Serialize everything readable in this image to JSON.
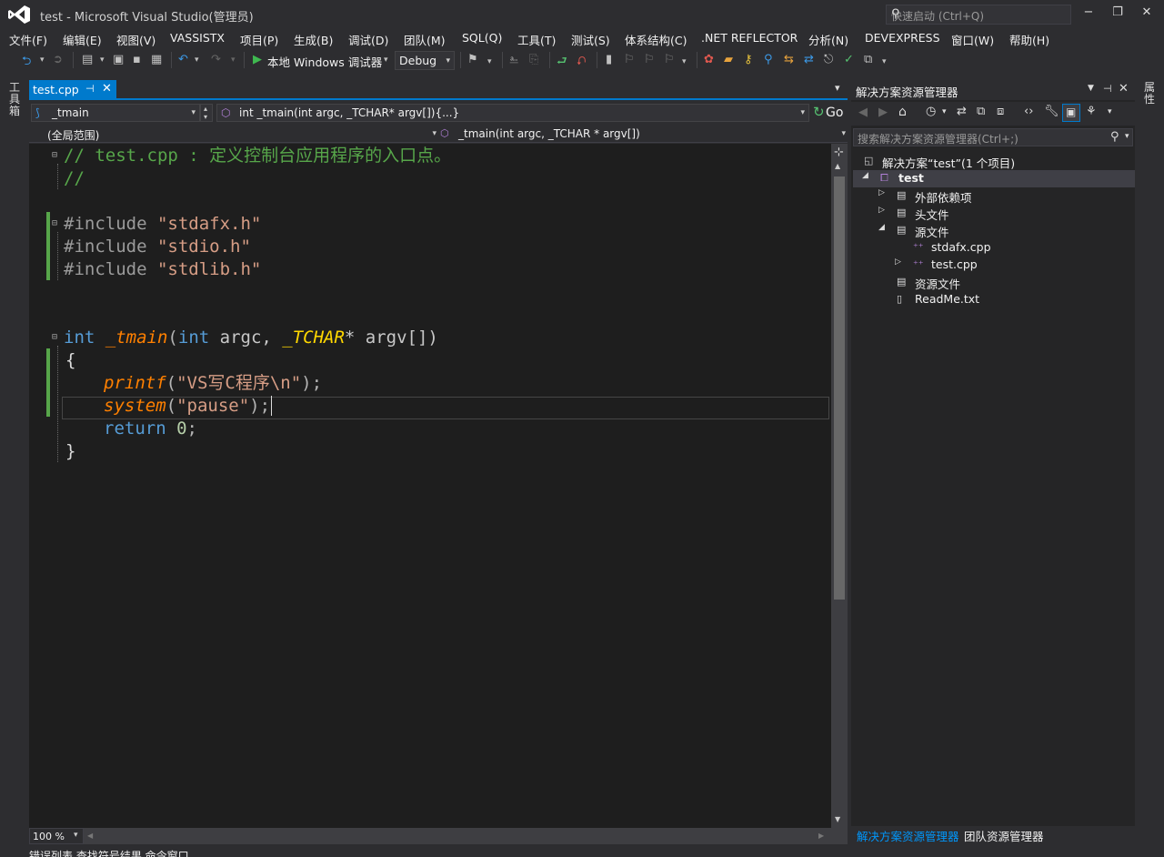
{
  "window": {
    "title": "test - Microsoft Visual Studio(管理员)",
    "quick_launch_placeholder": "快速启动 (Ctrl+Q)",
    "minimize": "−",
    "restore": "❐",
    "close": "✕"
  },
  "menu": [
    "文件(F)",
    "编辑(E)",
    "视图(V)",
    "VASSISTX",
    "项目(P)",
    "生成(B)",
    "调试(D)",
    "团队(M)",
    "SQL(Q)",
    "工具(T)",
    "测试(S)",
    "体系结构(C)",
    ".NET REFLECTOR",
    "分析(N)",
    "DEVEXPRESS",
    "窗口(W)",
    "帮助(H)"
  ],
  "toolbar": {
    "run_label": "本地 Windows 调试器",
    "config": "Debug"
  },
  "left_rail_label": "工具箱",
  "right_rail_label": "属性",
  "editor": {
    "tab_name": "test.cpp",
    "tab_pin": "⊣",
    "tab_close": "✕",
    "scope_combo": "_tmain",
    "function_combo": "int _tmain(int argc, _TCHAR* argv[]){...}",
    "go_label": "Go",
    "global_scope": "(全局范围)",
    "member_combo": "_tmain(int argc, _TCHAR * argv[])",
    "zoom": "100 %",
    "lines": {
      "l1": "// test.cpp : 定义控制台应用程序的入口点。",
      "l2": "//",
      "inc_kw": "#include",
      "inc1": "\"stdafx.h\"",
      "inc2": "\"stdio.h\"",
      "inc3": "\"stdlib.h\"",
      "m_int1": "int",
      "m_fn": "_tmain",
      "m_open": "(",
      "m_int2": "int",
      "m_argc": " argc, ",
      "m_tchar": "_TCHAR",
      "m_rest": "* argv[])",
      "brace_open": "{",
      "printf_fn": "printf",
      "printf_str": "\"VS写C程序\\n\"",
      "system_fn": "system",
      "system_str": "\"pause\"",
      "return_kw": "return",
      "return_val": "0",
      "brace_close": "}"
    }
  },
  "solution_explorer": {
    "title": "解决方案资源管理器",
    "search_placeholder": "搜索解决方案资源管理器(Ctrl+;)",
    "solution": "解决方案“test”(1 个项目)",
    "project": "test",
    "items": {
      "external": "外部依赖项",
      "headers": "头文件",
      "sources": "源文件",
      "stdafx": "stdafx.cpp",
      "testcpp": "test.cpp",
      "resources": "资源文件",
      "readme": "ReadMe.txt"
    },
    "tab_active": "解决方案资源管理器",
    "tab_other": "团队资源管理器"
  },
  "bottom_tabs": "错误列表   查找符号结果   命令窗口"
}
